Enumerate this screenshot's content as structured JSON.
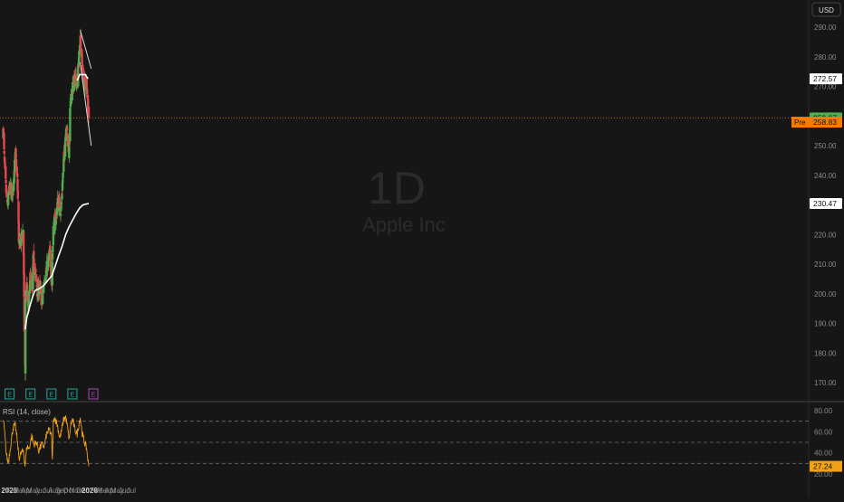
{
  "currency": "USD",
  "watermark": {
    "interval": "1D",
    "name": "Apple Inc"
  },
  "colors": {
    "background": "#161616",
    "up": "#4caf50",
    "down": "#e5474e",
    "ma": "#ffffff",
    "rsi_line": "#f2a215",
    "price_line": "#f29a1f",
    "last_price_badge": "#4caf50",
    "pre_badge": "#f57c00",
    "earnings": "#26a69a",
    "earnings_future": "#ab47bc",
    "text": "#8a8a8a"
  },
  "chart_data": [
    {
      "type": "candlestick",
      "title": "",
      "y_ticks": [
        "170.00",
        "180.00",
        "190.00",
        "200.00",
        "210.00",
        "220.00",
        "230.00",
        "240.00",
        "250.00",
        "260.00",
        "270.00",
        "280.00",
        "290.00"
      ],
      "ylim": [
        166,
        292
      ],
      "x_ticks": [
        "2025",
        "Feb",
        "Mar",
        "Apr",
        "May",
        "Jun",
        "Jul",
        "Aug",
        "Sep",
        "Oct",
        "Nov",
        "Dec",
        "2026",
        "Feb",
        "Mar",
        "Apr",
        "May",
        "Jun",
        "Jul"
      ],
      "anchors": [
        [
          "2025-01-02",
          255
        ],
        [
          "2025-01-10",
          240
        ],
        [
          "2025-01-20",
          229
        ],
        [
          "2025-01-31",
          236
        ],
        [
          "2025-02-10",
          233
        ],
        [
          "2025-02-25",
          247
        ],
        [
          "2025-03-05",
          238
        ],
        [
          "2025-03-12",
          216
        ],
        [
          "2025-03-21",
          218
        ],
        [
          "2025-03-31",
          222
        ],
        [
          "2025-04-04",
          188
        ],
        [
          "2025-04-08",
          172
        ],
        [
          "2025-04-09",
          198
        ],
        [
          "2025-04-14",
          203
        ],
        [
          "2025-04-21",
          194
        ],
        [
          "2025-05-02",
          207
        ],
        [
          "2025-05-09",
          199
        ],
        [
          "2025-05-13",
          212
        ],
        [
          "2025-05-20",
          208
        ],
        [
          "2025-05-30",
          201
        ],
        [
          "2025-06-10",
          202
        ],
        [
          "2025-06-20",
          197
        ],
        [
          "2025-06-30",
          205
        ],
        [
          "2025-07-15",
          210
        ],
        [
          "2025-07-25",
          214
        ],
        [
          "2025-08-01",
          203
        ],
        [
          "2025-08-08",
          222
        ],
        [
          "2025-08-20",
          226
        ],
        [
          "2025-08-29",
          232
        ],
        [
          "2025-09-10",
          228
        ],
        [
          "2025-09-22",
          244
        ],
        [
          "2025-10-03",
          257
        ],
        [
          "2025-10-15",
          248
        ],
        [
          "2025-10-21",
          263
        ],
        [
          "2025-10-31",
          270
        ],
        [
          "2025-11-14",
          273
        ],
        [
          "2025-11-21",
          272
        ],
        [
          "2025-11-28",
          280
        ],
        [
          "2025-12-03",
          286
        ],
        [
          "2025-12-10",
          279
        ],
        [
          "2025-12-18",
          273
        ],
        [
          "2025-12-30",
          271
        ],
        [
          "2026-01-05",
          265
        ],
        [
          "2026-01-09",
          259.37
        ]
      ],
      "ma_points": [
        [
          "2025-04-08",
          188
        ],
        [
          "2025-04-15",
          192
        ],
        [
          "2025-04-25",
          195
        ],
        [
          "2025-05-10",
          199
        ],
        [
          "2025-05-20",
          201
        ],
        [
          "2025-06-01",
          201.5
        ],
        [
          "2025-06-15",
          202
        ],
        [
          "2025-06-30",
          203
        ],
        [
          "2025-07-15",
          204.5
        ],
        [
          "2025-08-01",
          206
        ],
        [
          "2025-08-15",
          209
        ],
        [
          "2025-09-01",
          213
        ],
        [
          "2025-09-15",
          216
        ],
        [
          "2025-10-01",
          220
        ],
        [
          "2025-10-15",
          222.5
        ],
        [
          "2025-11-01",
          225
        ],
        [
          "2025-11-15",
          227
        ],
        [
          "2025-12-01",
          229
        ],
        [
          "2025-12-15",
          230
        ],
        [
          "2026-01-09",
          230.47
        ]
      ],
      "channel": [
        [
          [
            "2025-12-03",
            289
          ],
          [
            "2026-01-20",
            276
          ]
        ],
        [
          [
            "2025-12-03",
            278
          ],
          [
            "2026-01-20",
            250
          ]
        ]
      ],
      "ma_flat": [
        [
          "2025-11-20",
          272
        ],
        [
          "2025-12-01",
          274
        ],
        [
          "2025-12-25",
          274
        ],
        [
          "2026-01-06",
          272.57
        ]
      ],
      "last_price": "259.37",
      "last_price_value": 259.37,
      "pre_label": "Pre",
      "pre_price": "258.83",
      "pre_price_value": 258.83,
      "ma_long_label": "230.47",
      "ma_long_value": 230.47,
      "ma_short_label": "272.57",
      "ma_short_value": 272.57,
      "earnings": [
        {
          "date": "2025-01-30",
          "label": "E",
          "future": false
        },
        {
          "date": "2025-05-01",
          "label": "E",
          "future": false
        },
        {
          "date": "2025-07-31",
          "label": "E",
          "future": false
        },
        {
          "date": "2025-10-30",
          "label": "E",
          "future": false
        },
        {
          "date": "2026-01-29",
          "label": "E",
          "future": true
        }
      ]
    },
    {
      "type": "line",
      "title": "RSI (14, close)",
      "y_ticks": [
        "20.00",
        "40.00",
        "60.00",
        "80.00"
      ],
      "ylim": [
        15,
        92
      ],
      "levels": [
        70,
        50,
        30
      ],
      "current_label": "27.24",
      "current_value": 27.24,
      "rsi_points": [
        [
          "2025-01-02",
          72
        ],
        [
          "2025-01-08",
          60
        ],
        [
          "2025-01-15",
          40
        ],
        [
          "2025-01-24",
          30
        ],
        [
          "2025-02-04",
          48
        ],
        [
          "2025-02-14",
          64
        ],
        [
          "2025-02-24",
          66
        ],
        [
          "2025-03-04",
          52
        ],
        [
          "2025-03-12",
          35
        ],
        [
          "2025-03-22",
          40
        ],
        [
          "2025-03-31",
          42
        ],
        [
          "2025-04-07",
          28
        ],
        [
          "2025-04-15",
          46
        ],
        [
          "2025-04-25",
          44
        ],
        [
          "2025-05-06",
          56
        ],
        [
          "2025-05-15",
          48
        ],
        [
          "2025-05-28",
          50
        ],
        [
          "2025-06-06",
          42
        ],
        [
          "2025-06-18",
          48
        ],
        [
          "2025-06-30",
          46
        ],
        [
          "2025-07-10",
          58
        ],
        [
          "2025-07-22",
          62
        ],
        [
          "2025-07-31",
          56
        ],
        [
          "2025-08-04",
          32
        ],
        [
          "2025-08-08",
          68
        ],
        [
          "2025-08-14",
          74
        ],
        [
          "2025-08-26",
          66
        ],
        [
          "2025-09-05",
          54
        ],
        [
          "2025-09-12",
          60
        ],
        [
          "2025-09-22",
          72
        ],
        [
          "2025-10-01",
          74
        ],
        [
          "2025-10-10",
          62
        ],
        [
          "2025-10-17",
          52
        ],
        [
          "2025-10-22",
          66
        ],
        [
          "2025-10-31",
          72
        ],
        [
          "2025-11-10",
          62
        ],
        [
          "2025-11-20",
          58
        ],
        [
          "2025-11-28",
          68
        ],
        [
          "2025-12-03",
          74
        ],
        [
          "2025-12-12",
          58
        ],
        [
          "2025-12-22",
          50
        ],
        [
          "2025-12-31",
          44
        ],
        [
          "2026-01-05",
          34
        ],
        [
          "2026-01-09",
          27.24
        ]
      ]
    }
  ]
}
